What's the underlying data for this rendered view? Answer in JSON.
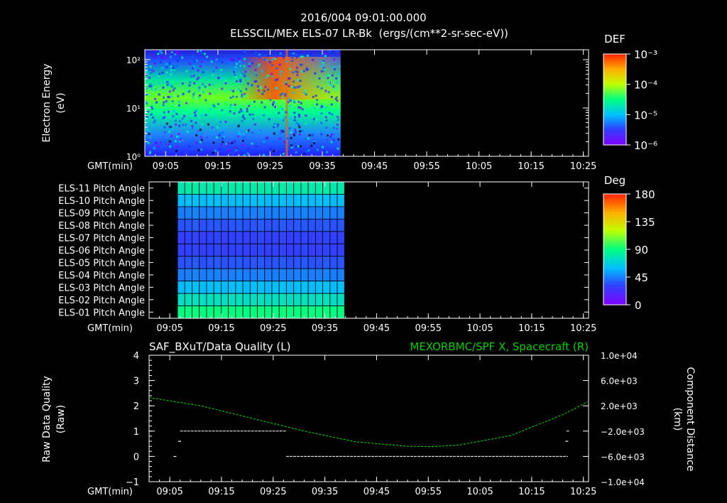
{
  "header": {
    "timestamp": "2016/004 09:01:00.000",
    "title": "ELSSCIL/MEx ELS-07 LR-Bk  (ergs/(cm**2-sr-sec-eV))"
  },
  "time_axis": {
    "label": "GMT(min)",
    "ticks": [
      "09:05",
      "09:15",
      "09:25",
      "09:35",
      "09:45",
      "09:55",
      "10:05",
      "10:15",
      "10:25"
    ],
    "tick_minutes": [
      545,
      555,
      565,
      575,
      585,
      595,
      605,
      615,
      625
    ],
    "range_minutes": [
      541,
      626
    ]
  },
  "colorbar_colors": [
    "#8000ff",
    "#3040ff",
    "#00c0ff",
    "#00ff80",
    "#c0ff00",
    "#ffb000",
    "#ff2000"
  ],
  "chart_data": [
    {
      "type": "heatmap",
      "name": "spectrogram",
      "ylabel": "Electron Energy (eV)",
      "ylabel_lines": [
        "Electron Energy",
        "(eV)"
      ],
      "yscale": "log",
      "ylim": [
        1,
        160
      ],
      "ytick_labels": [
        "10²",
        "10¹",
        "10⁰"
      ],
      "ytick_values": [
        100,
        10,
        1
      ],
      "data_time_range_minutes": [
        541,
        578.5
      ],
      "colorbar": {
        "label": "DEF",
        "scale": "log",
        "tick_labels": [
          "10⁻³",
          "10⁻⁴",
          "10⁻⁵",
          "10⁻⁶"
        ],
        "tick_values": [
          0.001,
          0.0001,
          1e-05,
          1e-06
        ]
      }
    },
    {
      "type": "heatmap",
      "name": "pitch angle",
      "row_labels": [
        "ELS-11 Pitch Angle",
        "ELS-10 Pitch Angle",
        "ELS-09 Pitch Angle",
        "ELS-08 Pitch Angle",
        "ELS-07 Pitch Angle",
        "ELS-06 Pitch Angle",
        "ELS-05 Pitch Angle",
        "ELS-04 Pitch Angle",
        "ELS-03 Pitch Angle",
        "ELS-02 Pitch Angle",
        "ELS-01 Pitch Angle"
      ],
      "row_values_deg": [
        80,
        60,
        45,
        35,
        30,
        30,
        35,
        45,
        60,
        75,
        90
      ],
      "data_time_range_minutes": [
        546.5,
        578.8
      ],
      "colorbar": {
        "label": "Deg",
        "range": [
          0,
          180
        ],
        "tick_labels": [
          "180",
          "135",
          "90",
          "45",
          "0"
        ],
        "tick_values": [
          180,
          135,
          90,
          45,
          0
        ]
      }
    },
    {
      "type": "line",
      "name": "data quality and spacecraft position",
      "left_title": "SAF_BXuT/Data Quality (L)",
      "right_title": "MEXORBMC/SPF X, Spacecraft (R)",
      "ylabel_left_lines": [
        "Raw Data Quality",
        "(Raw)"
      ],
      "ylabel_right_lines": [
        "Component Distance",
        "(km)"
      ],
      "ylim_left": [
        -1,
        4
      ],
      "yticks_left": [
        "4",
        "3",
        "2",
        "1",
        "0",
        "−1"
      ],
      "ylim_right": [
        -10000,
        10000
      ],
      "yticks_right": [
        "1.0e+04",
        "6.0e+03",
        "2.0e+03",
        "−2.0e+03",
        "−6.0e+03",
        "−1.0e+04"
      ],
      "ytick_values_right": [
        10000,
        6000,
        2000,
        -2000,
        -6000,
        -10000
      ],
      "series": [
        {
          "name": "SAF_BXuT/Data Quality",
          "axis": "left",
          "color": "#ffffff",
          "segments": [
            {
              "x": [
                547,
                567.5
              ],
              "y": [
                1,
                1
              ]
            },
            {
              "x": [
                567.5,
                622
              ],
              "y": [
                0,
                0
              ]
            },
            {
              "x": [
                621.7,
                622.3
              ],
              "y": [
                1,
                1
              ]
            }
          ],
          "points": [
            [
              546,
              0
            ],
            [
              546.9,
              0.6
            ],
            [
              621.8,
              0.6
            ]
          ]
        },
        {
          "name": "MEXORBMC/SPF X, Spacecraft",
          "axis": "right",
          "color": "#00c800",
          "x": [
            541,
            551,
            561,
            571,
            581,
            591,
            596,
            601,
            611,
            621,
            626
          ],
          "y": [
            3300,
            2000,
            0,
            -2000,
            -3700,
            -4400,
            -4450,
            -4200,
            -2700,
            600,
            2700
          ]
        }
      ]
    }
  ]
}
